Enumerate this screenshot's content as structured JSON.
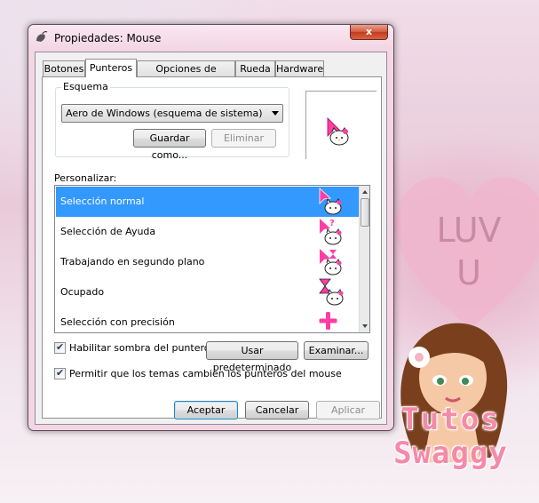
{
  "window": {
    "title": "Propiedades: Mouse",
    "close_glyph": "x"
  },
  "tabs": [
    {
      "label": "Botones"
    },
    {
      "label": "Punteros"
    },
    {
      "label": "Opciones de puntero"
    },
    {
      "label": "Rueda"
    },
    {
      "label": "Hardware"
    }
  ],
  "active_tab": "Punteros",
  "scheme": {
    "group_label": "Esquema",
    "selected": "Aero de Windows (esquema de sistema)",
    "save_label": "Guardar como...",
    "delete_label": "Eliminar"
  },
  "customize": {
    "label": "Personalizar:",
    "items": [
      {
        "label": "Selección normal",
        "icon": "arrow-hello-kitty-icon"
      },
      {
        "label": "Selección de Ayuda",
        "icon": "help-hello-kitty-icon"
      },
      {
        "label": "Trabajando en segundo plano",
        "icon": "busy-arrow-hello-kitty-icon"
      },
      {
        "label": "Ocupado",
        "icon": "hourglass-hello-kitty-icon"
      },
      {
        "label": "Selección con precisión",
        "icon": "precision-cross-icon"
      }
    ]
  },
  "options": {
    "shadow_label": "Habilitar sombra del puntero",
    "shadow_checked": true,
    "default_label": "Usar predeterminado",
    "browse_label": "Examinar...",
    "themes_label": "Permitir que los temas cambien los punteros del mouse",
    "themes_checked": true
  },
  "footer": {
    "ok": "Aceptar",
    "cancel": "Cancelar",
    "apply": "Aplicar"
  },
  "background": {
    "heart_text_1": "LUV",
    "heart_text_2": "U",
    "watermark_1": "Tutos",
    "watermark_2": "Swaggy"
  },
  "colors": {
    "selection": "#3399ff",
    "cursor_pink": "#ff3ea5",
    "watermark": "#f58aa8"
  }
}
